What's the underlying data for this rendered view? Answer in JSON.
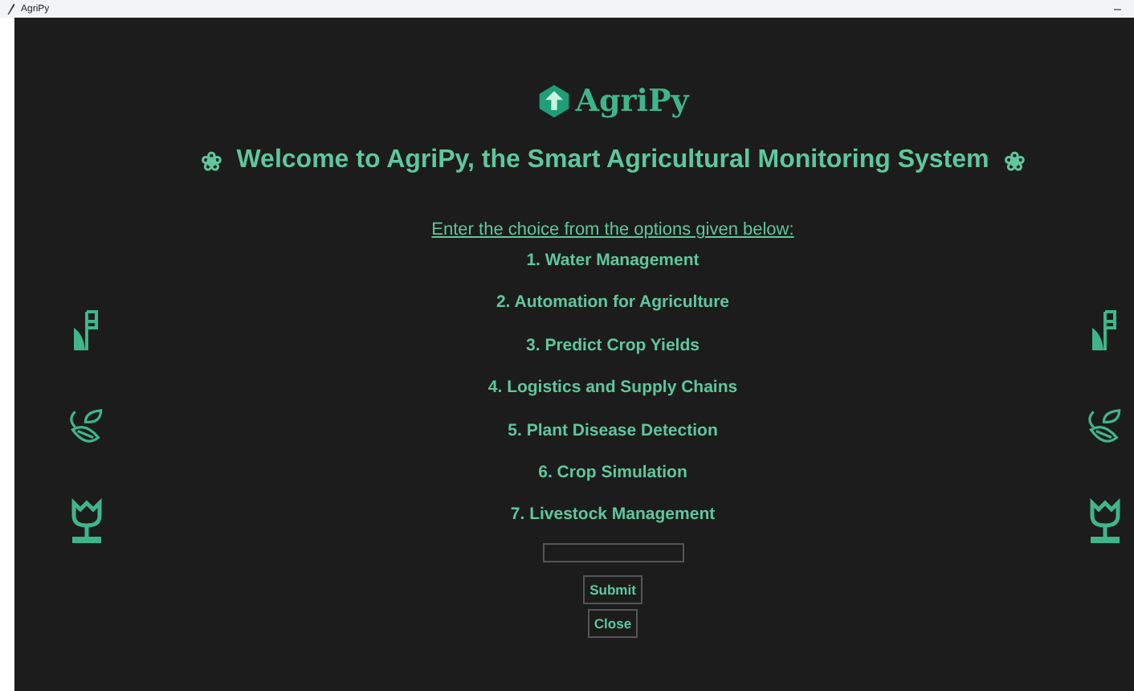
{
  "window": {
    "title": "AgriPy",
    "minimize": "–"
  },
  "logo": {
    "text": "AgriPy"
  },
  "welcome": {
    "mark": "❀",
    "text": "Welcome to AgriPy, the Smart Agricultural Monitoring System"
  },
  "prompt": "Enter the choice from the options given below:",
  "options": [
    {
      "label": "1. Water Management"
    },
    {
      "label": "2. Automation for Agriculture"
    },
    {
      "label": "3. Predict Crop Yields"
    },
    {
      "label": "4. Logistics and Supply Chains"
    },
    {
      "label": "5. Plant Disease Detection"
    },
    {
      "label": "6. Crop Simulation"
    },
    {
      "label": "7. Livestock Management"
    }
  ],
  "buttons": [
    "Submit",
    "Close"
  ]
}
